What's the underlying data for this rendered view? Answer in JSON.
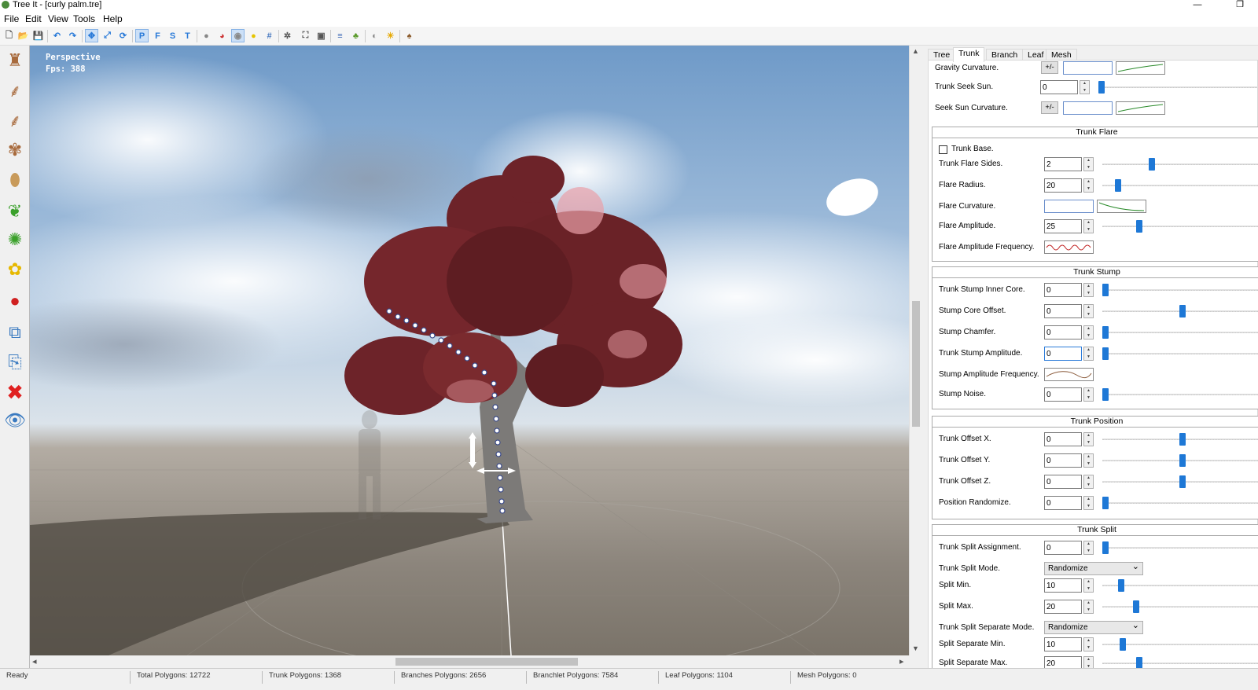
{
  "window": {
    "title": "Tree It - [curly palm.tre]",
    "minimize": "—",
    "restore": "❐"
  },
  "menu": [
    "File",
    "Edit",
    "View",
    "Tools",
    "Help"
  ],
  "toolbar": {
    "view_p": "P",
    "view_f": "F",
    "view_s": "S",
    "view_t": "T"
  },
  "viewport": {
    "mode": "Perspective",
    "fps": "Fps: 388"
  },
  "tabs": [
    "Tree",
    "Trunk",
    "Branch",
    "Leaf",
    "Mesh"
  ],
  "active_tab": "Trunk",
  "top_rows": {
    "gravity_curvature": {
      "label": "Gravity Curvature.",
      "pm": "+/-"
    },
    "trunk_seek_sun": {
      "label": "Trunk Seek Sun.",
      "value": "0",
      "level": 0
    },
    "seek_sun_curvature": {
      "label": "Seek Sun Curvature.",
      "pm": "+/-"
    }
  },
  "trunk_flare": {
    "title": "Trunk Flare",
    "trunk_base": "Trunk Base.",
    "sides": {
      "label": "Trunk Flare Sides.",
      "value": "2",
      "level": 0.3
    },
    "radius": {
      "label": "Flare Radius.",
      "value": "20",
      "level": 0.08
    },
    "curvature": {
      "label": "Flare Curvature."
    },
    "amplitude": {
      "label": "Flare Amplitude.",
      "value": "25",
      "level": 0.22
    },
    "amp_freq": {
      "label": "Flare Amplitude Frequency."
    }
  },
  "trunk_stump": {
    "title": "Trunk Stump",
    "inner_core": {
      "label": "Trunk Stump Inner Core.",
      "value": "0",
      "level": 0
    },
    "core_offset": {
      "label": "Stump Core Offset.",
      "value": "0",
      "level": 0.5
    },
    "chamfer": {
      "label": "Stump Chamfer.",
      "value": "0",
      "level": 0
    },
    "amplitude": {
      "label": "Trunk Stump Amplitude.",
      "value": "0",
      "level": 0
    },
    "amp_freq": {
      "label": "Stump Amplitude Frequency."
    },
    "noise": {
      "label": "Stump Noise.",
      "value": "0",
      "level": 0
    }
  },
  "trunk_position": {
    "title": "Trunk Position",
    "offset_x": {
      "label": "Trunk Offset X.",
      "value": "0",
      "level": 0.5
    },
    "offset_y": {
      "label": "Trunk Offset Y.",
      "value": "0",
      "level": 0.5
    },
    "offset_z": {
      "label": "Trunk Offset Z.",
      "value": "0",
      "level": 0.5
    },
    "randomize": {
      "label": "Position Randomize.",
      "value": "0",
      "level": 0
    }
  },
  "trunk_split": {
    "title": "Trunk Split",
    "assignment": {
      "label": "Trunk Split Assignment.",
      "value": "0",
      "level": 0
    },
    "mode": {
      "label": "Trunk Split Mode.",
      "value": "Randomize"
    },
    "min": {
      "label": "Split Min.",
      "value": "10",
      "level": 0.1
    },
    "max": {
      "label": "Split Max.",
      "value": "20",
      "level": 0.2
    },
    "sep_mode": {
      "label": "Trunk Split Separate Mode.",
      "value": "Randomize"
    },
    "sep_min": {
      "label": "Split Separate Min.",
      "value": "10",
      "level": 0.11
    },
    "sep_max": {
      "label": "Split Separate Max.",
      "value": "20",
      "level": 0.22
    }
  },
  "status": {
    "ready": "Ready",
    "total": "Total Polygons: 12722",
    "trunk": "Trunk Polygons: 1368",
    "branches": "Branches Polygons: 2656",
    "branchlet": "Branchlet Polygons: 7584",
    "leaf": "Leaf Polygons: 1104",
    "mesh": "Mesh Polygons: 0"
  },
  "colors": {
    "accent": "#1e78d6",
    "leaf": "#7a2a2e",
    "blossom": "#e9a0a8",
    "trunk": "#7c7a78"
  }
}
